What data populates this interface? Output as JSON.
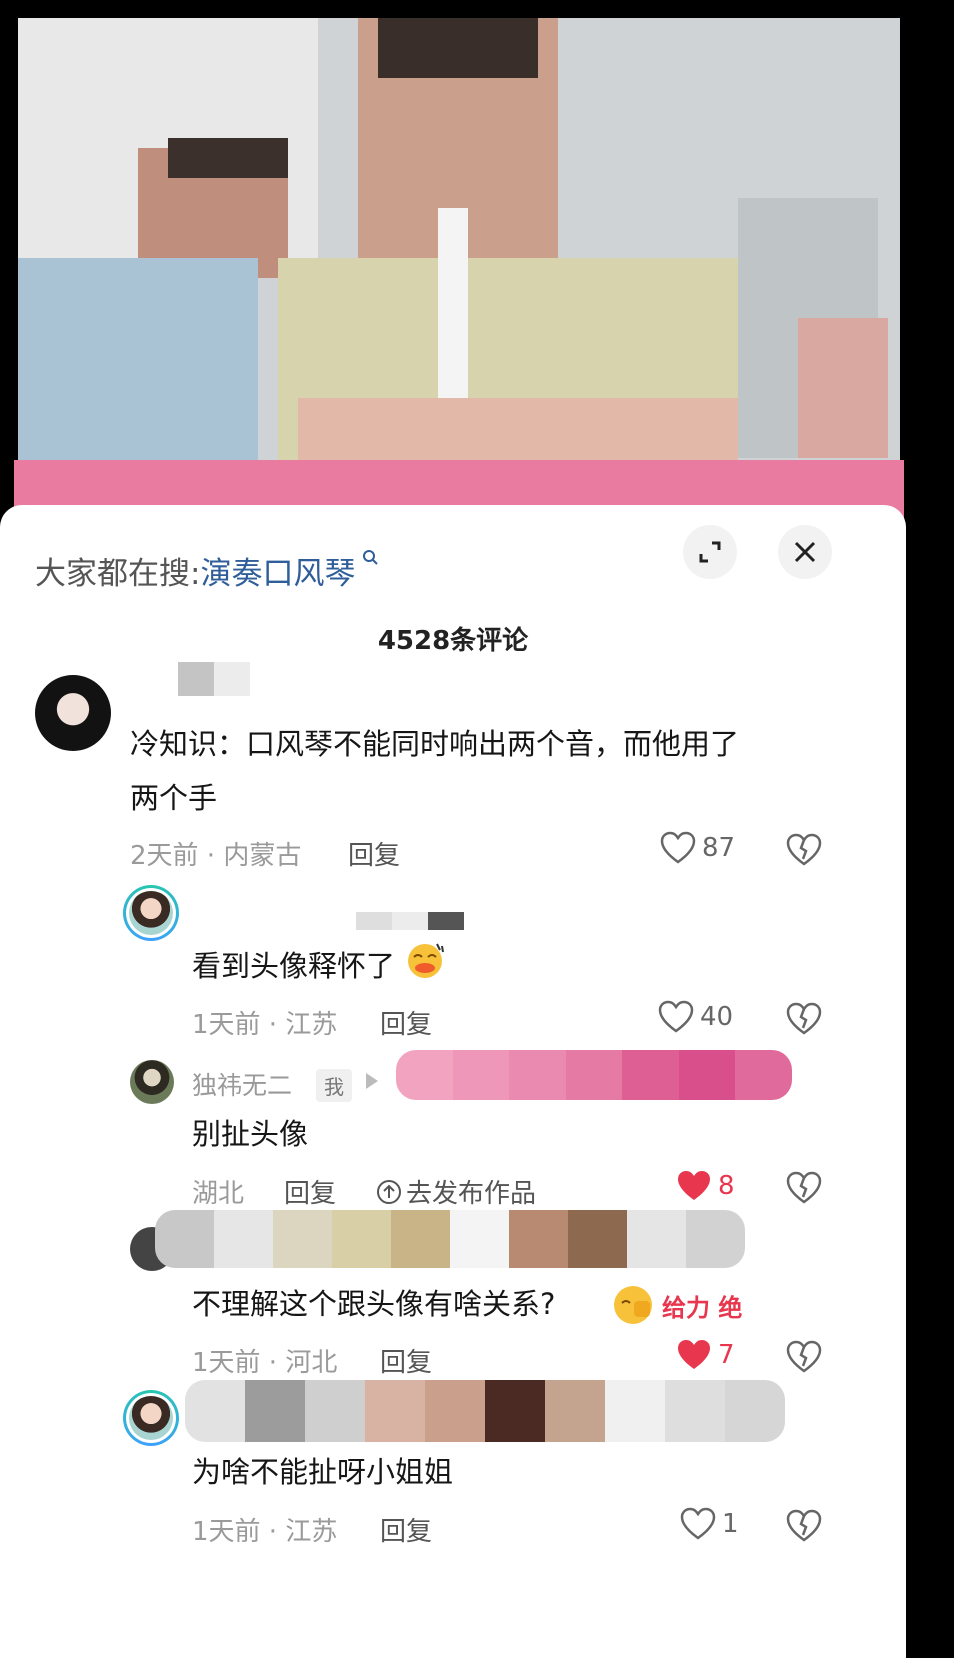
{
  "search": {
    "label": "大家都在搜:",
    "keyword": "演奏口风琴"
  },
  "comment_count": "4528条评论",
  "comments": [
    {
      "text_line1": "冷知识：口风琴不能同时响出两个音，而他用了",
      "text_line2": "两个手",
      "time_location": "2天前 · 内蒙古",
      "reply": "回复",
      "likes": "87",
      "liked": false
    },
    {
      "text": "看到头像释怀了",
      "time_location": "1天前 · 江苏",
      "reply": "回复",
      "likes": "40",
      "liked": false
    },
    {
      "username": "独祎无二",
      "me_tag": "我",
      "text": "别扯头像",
      "location": "湖北",
      "reply": "回复",
      "publish": "去发布作品",
      "likes": "8",
      "liked": true
    },
    {
      "text": "不理解这个跟头像有啥关系?",
      "sticker_text": "给力 绝",
      "time_location": "1天前 · 河北",
      "reply": "回复",
      "likes": "7",
      "liked": true
    },
    {
      "text": "为啥不能扯呀小姐姐",
      "time_location": "1天前 · 江苏",
      "reply": "回复",
      "likes": "1",
      "liked": false
    }
  ],
  "colors": {
    "link": "#2f5e9a",
    "like_red": "#e8364e",
    "meta_gray": "#9a9a9a"
  },
  "icons": [
    "search-icon",
    "collapse-icon",
    "close-icon",
    "heart-icon",
    "broken-heart-icon",
    "upload-icon",
    "play-arrow-icon"
  ]
}
